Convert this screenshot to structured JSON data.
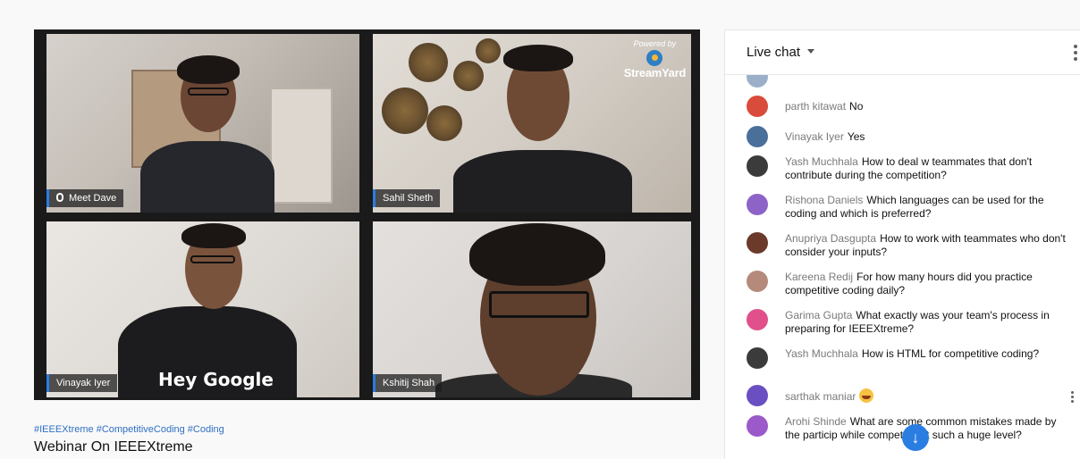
{
  "video": {
    "tiles": [
      {
        "name": "Meet Dave"
      },
      {
        "name": "Sahil Sheth"
      },
      {
        "name": "Vinayak Iyer"
      },
      {
        "name": "Kshitij Shah"
      }
    ],
    "powered_by": "Powered by",
    "brand": "StreamYard",
    "shirt_text": "Hey Google"
  },
  "hashtags": "#IEEEXtreme #CompetitiveCoding #Coding",
  "title": "Webinar On IEEEXtreme",
  "chat": {
    "title": "Live chat",
    "messages": [
      {
        "author": "parth kitawat",
        "text": "No",
        "avatar_color": "#d94b3a"
      },
      {
        "author": "Vinayak Iyer",
        "text": "Yes",
        "avatar_color": "#4a6f9a"
      },
      {
        "author": "Yash Muchhala",
        "text": "How to deal w teammates that don't contribute during the competition?",
        "avatar_color": "#3b3b3b"
      },
      {
        "author": "Rishona Daniels",
        "text": "Which languages can be used for the coding and which is preferred?",
        "avatar_color": "#8e63c7"
      },
      {
        "author": "Anupriya Dasgupta",
        "text": "How to work with teammates who don't consider your inputs?",
        "avatar_color": "#6b3a2a"
      },
      {
        "author": "Kareena Redij",
        "text": "For how many hours did you practice competitive coding daily?",
        "avatar_color": "#b58a7a"
      },
      {
        "author": "Garima Gupta",
        "text": "What exactly was your team's process in preparing for IEEEXtreme?",
        "avatar_color": "#e0508a"
      },
      {
        "author": "Yash Muchhala",
        "text": "How is HTML for competitive coding?",
        "avatar_color": "#3b3b3b"
      },
      {
        "author": "sarthak maniar",
        "text": "",
        "avatar_color": "#6a4fc2"
      },
      {
        "author": "Arohi Shinde",
        "text": "What are some common mistakes made by the particip    while competing at such a huge level?",
        "avatar_color": "#9b59c9"
      }
    ]
  }
}
